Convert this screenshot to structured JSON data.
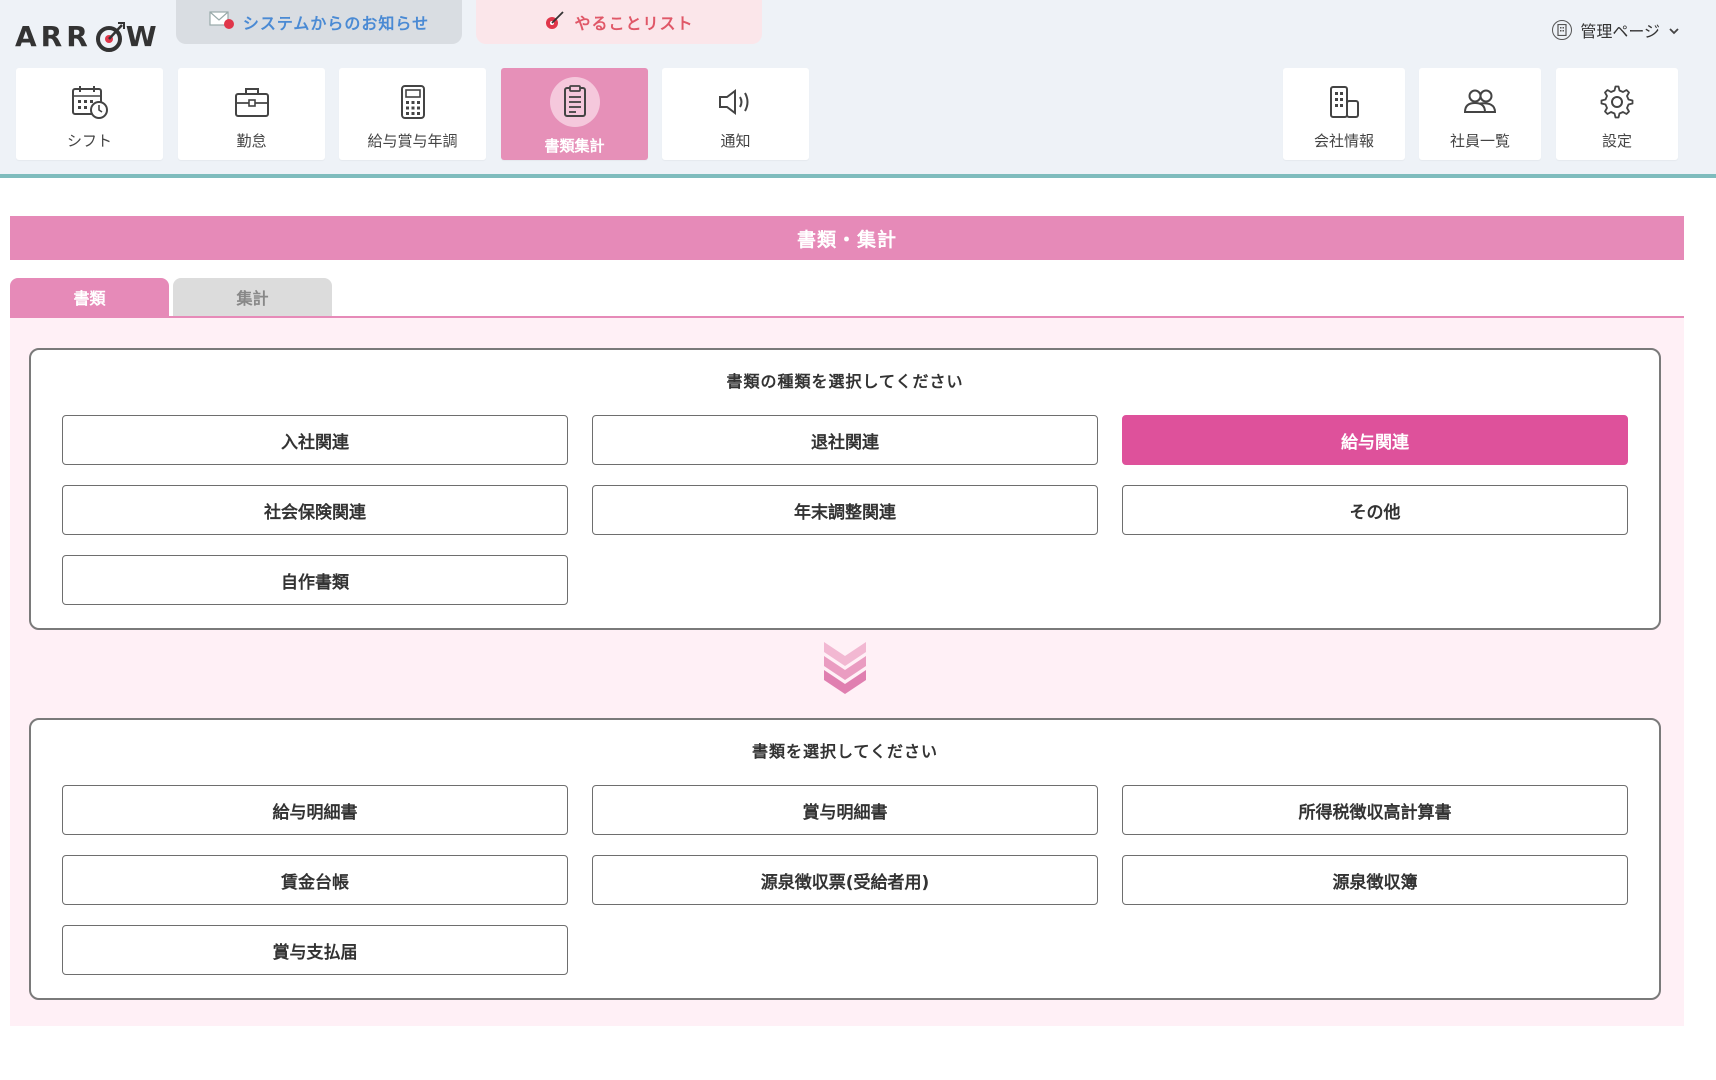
{
  "logo": {
    "text_before": "ARR",
    "text_after": "W"
  },
  "top_buttons": {
    "notice": "システムからのお知らせ",
    "todo": "やることリスト"
  },
  "admin": {
    "label": "管理ページ"
  },
  "nav_left": [
    {
      "label": "シフト",
      "icon": "calendar-clock-icon"
    },
    {
      "label": "勤怠",
      "icon": "briefcase-icon"
    },
    {
      "label": "給与賞与年調",
      "icon": "calculator-icon"
    },
    {
      "label": "書類集計",
      "icon": "document-icon",
      "active": true
    },
    {
      "label": "通知",
      "icon": "speaker-icon"
    }
  ],
  "nav_right": [
    {
      "label": "会社情報",
      "icon": "building-icon"
    },
    {
      "label": "社員一覧",
      "icon": "users-icon"
    },
    {
      "label": "設定",
      "icon": "gear-icon"
    }
  ],
  "page_title": "書類・集計",
  "tabs": {
    "active": "書類",
    "inactive": "集計"
  },
  "category_section": {
    "title": "書類の種類を選択してください",
    "options": [
      "入社関連",
      "退社関連",
      "給与関連",
      "社会保険関連",
      "年末調整関連",
      "その他",
      "自作書類"
    ],
    "selected": "給与関連"
  },
  "document_section": {
    "title": "書類を選択してください",
    "options": [
      "給与明細書",
      "賞与明細書",
      "所得税徴収高計算書",
      "賃金台帳",
      "源泉徴収票(受給者用)",
      "源泉徴収簿",
      "賞与支払届"
    ]
  },
  "colors": {
    "accent_pink": "#e68ab8",
    "selected_pink": "#de519b",
    "header_bg": "#eef2f7",
    "teal_line": "#7fbcbd"
  }
}
